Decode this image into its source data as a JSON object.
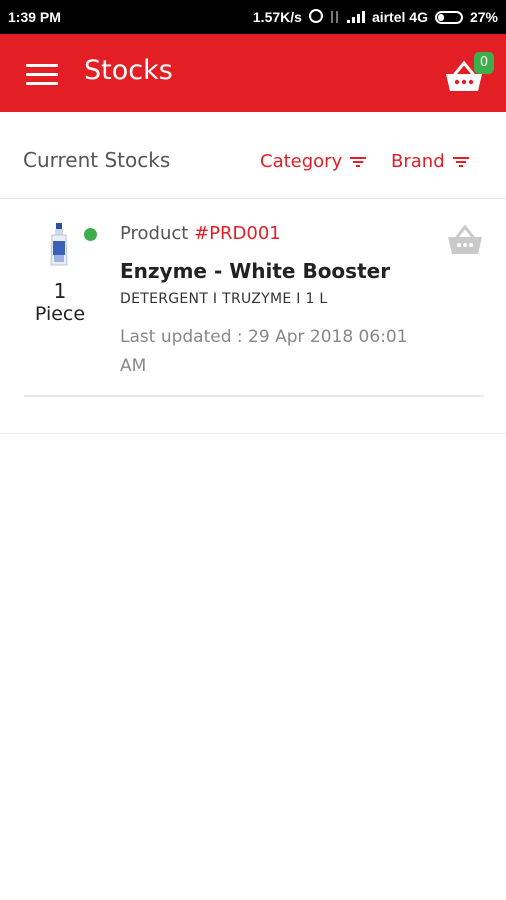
{
  "status_bar": {
    "time": "1:39 PM",
    "speed": "1.57K/s",
    "carrier": "airtel 4G",
    "battery": "27%"
  },
  "app_bar": {
    "title": "Stocks",
    "cart_count": "0",
    "accent_color": "#e31e24",
    "badge_color": "#3dae49"
  },
  "filters": {
    "section_title": "Current Stocks",
    "category_label": "Category",
    "brand_label": "Brand"
  },
  "products": [
    {
      "label": "Product",
      "id": "#PRD001",
      "name": "Enzyme - White Booster",
      "meta": "DETERGENT I TRUZYME I 1 L",
      "updated": "Last updated : 29 Apr 2018 06:01 AM",
      "quantity": "1",
      "unit": "Piece",
      "in_stock": true
    }
  ]
}
